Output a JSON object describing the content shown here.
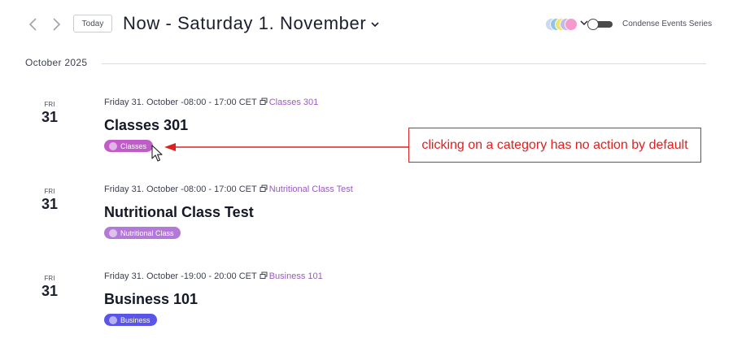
{
  "toolbar": {
    "today_label": "Today",
    "range_title": "Now - Saturday 1. November",
    "toggle_label": "Condense Events Series",
    "toggle_on": false,
    "category_colors": [
      "#c9d8f5",
      "#8ec5ec",
      "#f2e36b",
      "#c7b7f0",
      "#f59acb"
    ]
  },
  "month": {
    "label": "October 2025"
  },
  "events": [
    {
      "dow": "FRI",
      "day": "31",
      "meta": "Friday 31. October -08:00 - 17:00 CET",
      "series": "Classes 301",
      "title": "Classes 301",
      "category": "Classes",
      "category_color": "#c05cc8"
    },
    {
      "dow": "FRI",
      "day": "31",
      "meta": "Friday 31. October -08:00 - 17:00 CET",
      "series": "Nutritional Class Test",
      "title": "Nutritional Class Test",
      "category": "Nutritional Class",
      "category_color": "#b279d6"
    },
    {
      "dow": "FRI",
      "day": "31",
      "meta": "Friday 31. October -19:00 - 20:00 CET",
      "series": "Business 101",
      "title": "Business 101",
      "category": "Business",
      "category_color": "#5a55e8"
    }
  ],
  "annotation": {
    "text": "clicking on a category has no action by default",
    "color": "#e02020"
  }
}
